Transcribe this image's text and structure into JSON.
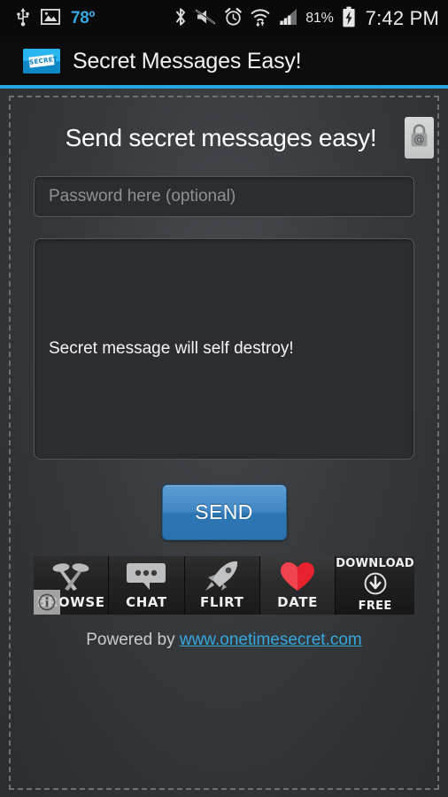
{
  "status_bar": {
    "usb_icon": "usb-icon",
    "gallery_icon": "image-icon",
    "temperature": "78º",
    "bluetooth_icon": "bluetooth-icon",
    "mute_icon": "volume-mute-icon",
    "alarm_icon": "alarm-clock-icon",
    "wifi_icon": "wifi-icon",
    "signal_icon": "cellular-signal-icon",
    "battery_percent": "81%",
    "battery_icon": "battery-charging-icon",
    "clock": "7:42 PM"
  },
  "app_bar": {
    "icon_name": "secret-envelope-icon",
    "icon_stamp_text": "SECRET",
    "title": "Secret Messages Easy!",
    "accent_color": "#27a5e0"
  },
  "main": {
    "headline": "Send secret messages easy!",
    "lock_button": {
      "name": "lock-at-button",
      "icon": "padlock-at-icon"
    },
    "password_field": {
      "placeholder": "Password here (optional)",
      "value": ""
    },
    "message_field": {
      "value": "Secret message will self destroy!",
      "placeholder": ""
    },
    "send_button_label": "SEND",
    "send_button_color": "#3f87c4"
  },
  "ad_banner": {
    "info_badge": "i",
    "cells": [
      {
        "label": "BROWSE",
        "icon": "crossed-magnifiers-icon",
        "highlight": false
      },
      {
        "label": "CHAT",
        "icon": "speech-bubble-icon",
        "highlight": false
      },
      {
        "label": "FLIRT",
        "icon": "rocket-icon",
        "highlight": false
      },
      {
        "label": "DATE",
        "icon": "heart-icon",
        "highlight": true
      }
    ],
    "cta": {
      "top_word": "DOWNLOAD",
      "icon": "download-arrow-icon",
      "bottom_word": "FREE"
    }
  },
  "footer": {
    "powered_prefix": "Powered by ",
    "link_text": "www.onetimesecret.com",
    "link_color": "#34a8e0"
  }
}
